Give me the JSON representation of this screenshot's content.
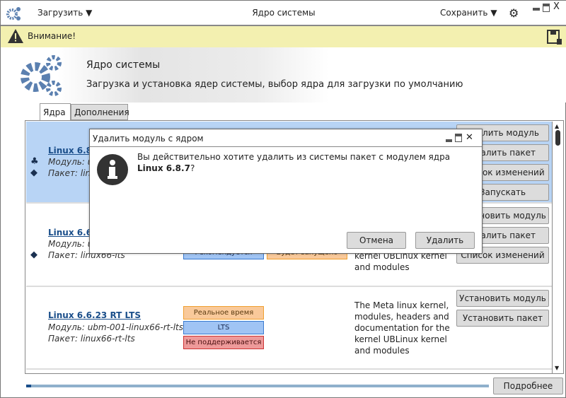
{
  "titlebar": {
    "load_label": "Загрузить",
    "title": "Ядро системы",
    "save_label": "Сохранить"
  },
  "warning": {
    "text": "Внимание!"
  },
  "header": {
    "title": "Ядро системы",
    "subtitle": "Загрузка и установка ядер системы, выбор ядра для загрузки по умолчанию"
  },
  "tabs": [
    {
      "label": "Ядра"
    },
    {
      "label": "Дополнения"
    }
  ],
  "rows": [
    {
      "name": "Linux 6.8.",
      "module": "Модуль: u",
      "package": "Пакет: lin",
      "buttons": [
        "Удалить модуль",
        "Удалить пакет",
        "Список изменений",
        "Запускать"
      ]
    },
    {
      "name": "Linux 6.6.",
      "module": "Модуль: u",
      "package": "Пакет: linux66-lts",
      "badges": [
        "Рекомендуется",
        "Будет запущено"
      ],
      "desc": "kernel UBLinux kernel and modules",
      "buttons": [
        "Установить модуль",
        "Удалить пакет",
        "Список изменений"
      ]
    },
    {
      "name": "Linux 6.6.23 RT LTS",
      "module": "Модуль: ubm-001-linux66-rt-lts",
      "package": "Пакет: linux66-rt-lts",
      "badges": [
        "Реальное время",
        "LTS",
        "Не поддерживается"
      ],
      "desc": "The Meta linux kernel, modules, headers and documentation for the kernel UBLinux kernel and modules",
      "buttons": [
        "Установить модуль",
        "Установить пакет"
      ]
    }
  ],
  "dialog": {
    "title": "Удалить модуль с ядром",
    "message": "Вы действительно хотите удалить из системы пакет с модулем ядра ",
    "message_bold": "Linux 6.8.7",
    "message_end": "?",
    "cancel": "Отмена",
    "delete": "Удалить"
  },
  "footer": {
    "more_label": "Подробнее",
    "progress": 0.01
  },
  "colors": {
    "accent": "#5b80b0",
    "selected": "#b8d4f5",
    "warning": "#f3f0b0"
  }
}
